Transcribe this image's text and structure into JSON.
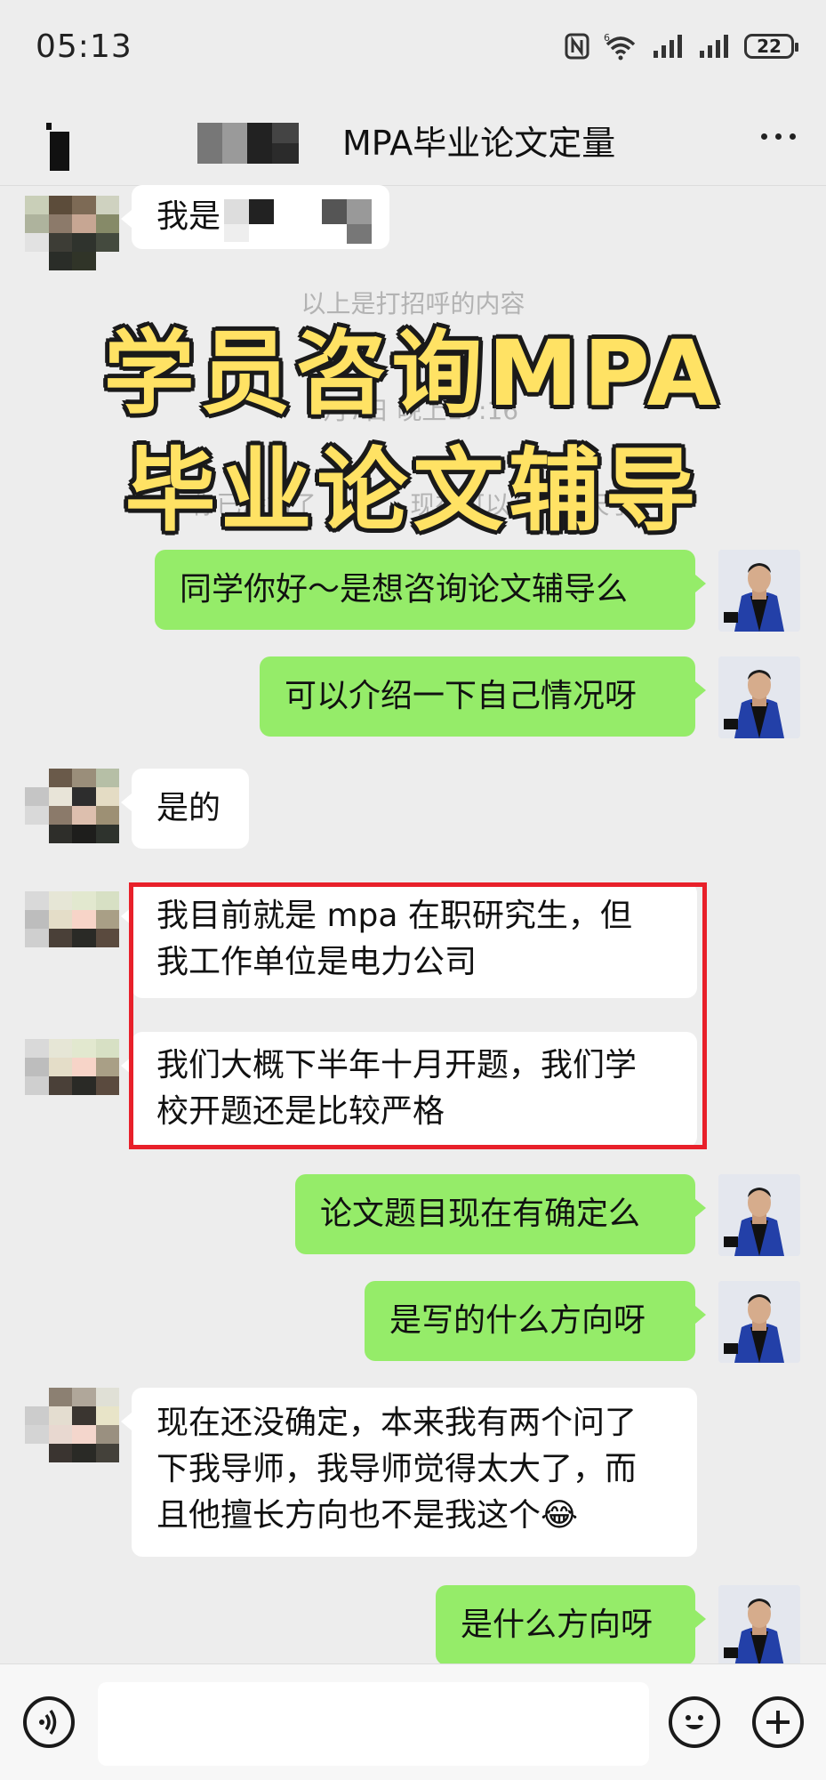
{
  "status_bar": {
    "time": "05:13",
    "battery": "22",
    "icons": [
      "nfc-icon",
      "wifi-icon",
      "signal-icon",
      "signal-icon",
      "battery-icon"
    ]
  },
  "header": {
    "title": "MPA毕业论文定量",
    "back_icon": "back-icon",
    "more_icon": "more-icon"
  },
  "chat": {
    "system": {
      "greeting_note": "以上是打招呼的内容",
      "timestamp": "1月7日 晚上17:16",
      "added_note": "你已添加了",
      "added_note_tail": "，现在可以开始聊天了"
    },
    "overlay": {
      "line1": "学员咨询MPA",
      "line2": "毕业论文辅导"
    },
    "messages": [
      {
        "side": "left",
        "text": "我是"
      },
      {
        "side": "right",
        "text": "同学你好～是想咨询论文辅导么"
      },
      {
        "side": "right",
        "text": "可以介绍一下自己情况呀"
      },
      {
        "side": "left",
        "text": "是的"
      },
      {
        "side": "left",
        "line1": "我目前就是 mpa 在职研究生，但",
        "line2": "我工作单位是电力公司"
      },
      {
        "side": "left",
        "line1": "我们大概下半年十月开题，我们学",
        "line2": "校开题还是比较严格"
      },
      {
        "side": "right",
        "text": "论文题目现在有确定么"
      },
      {
        "side": "right",
        "text": "是写的什么方向呀"
      },
      {
        "side": "left",
        "line1": "现在还没确定，本来我有两个问了",
        "line2": "下我导师，我导师觉得太大了，而",
        "line3": "且他擅长方向也不是我这个😂"
      },
      {
        "side": "right",
        "text": "是什么方向呀"
      }
    ]
  },
  "input_bar": {
    "voice_icon": "voice-icon",
    "emoji_icon": "emoji-icon",
    "plus_icon": "plus-icon",
    "placeholder": ""
  },
  "colors": {
    "background": "#ededed",
    "bubble_me": "#95ec69",
    "bubble_other": "#ffffff",
    "highlight": "#e8202a",
    "overlay_text": "#ffe264"
  }
}
